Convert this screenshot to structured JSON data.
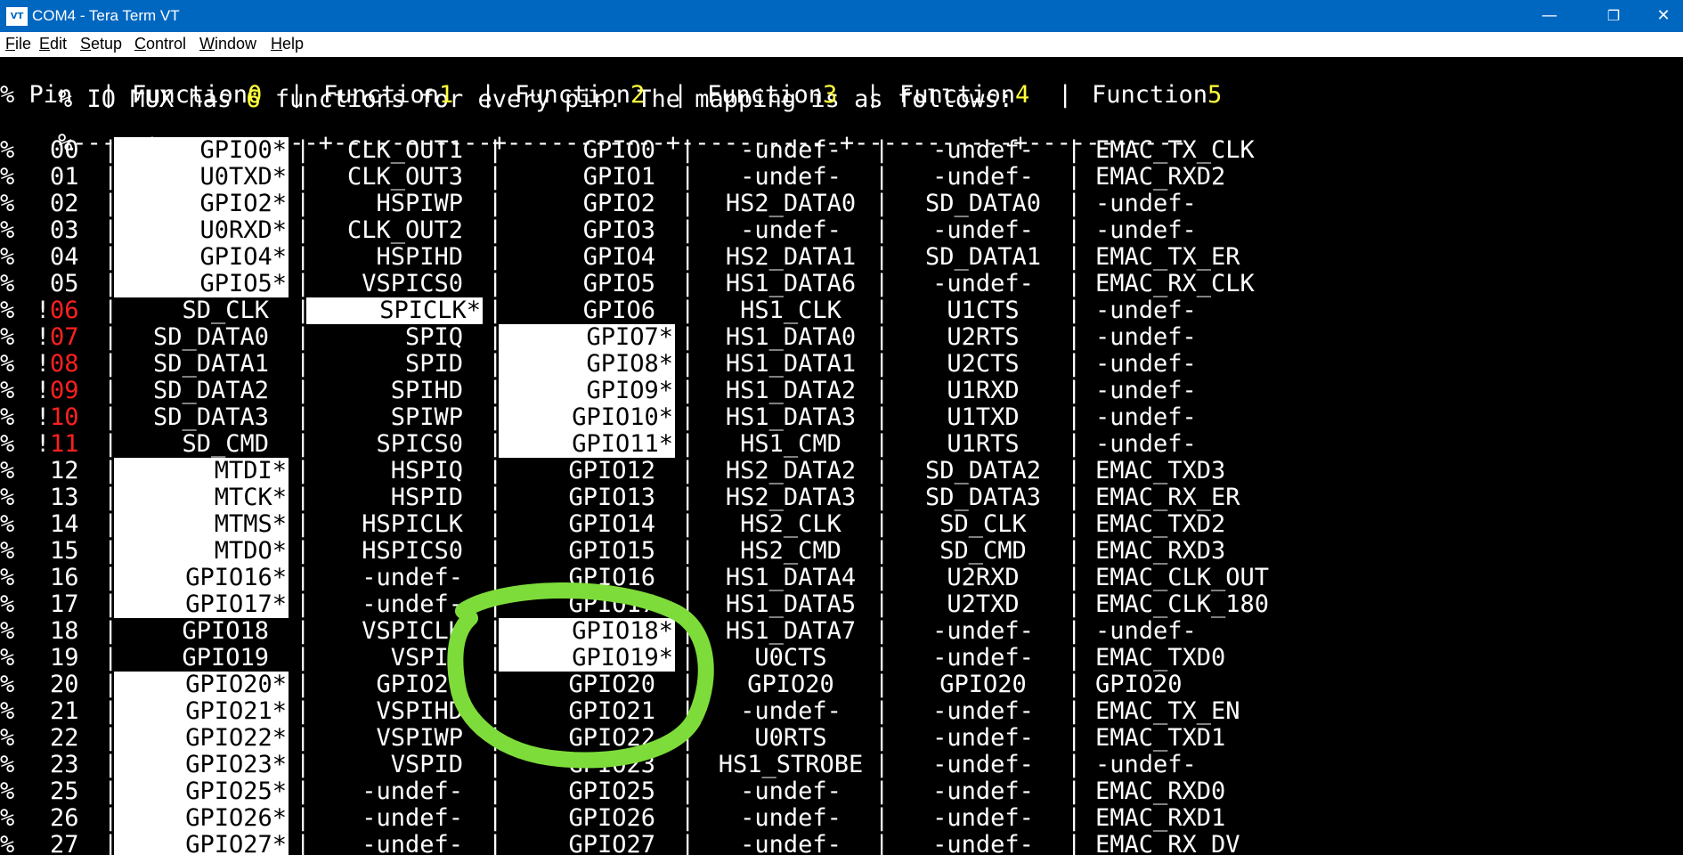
{
  "window": {
    "title": "COM4 - Tera Term VT",
    "icon_label": "VT",
    "icon": "tera-term-icon",
    "controls": {
      "minimize": "—",
      "restore": "❐",
      "close": "✕"
    }
  },
  "menu": [
    {
      "pre": "",
      "acc": "F",
      "post": "ile"
    },
    {
      "pre": "",
      "acc": "E",
      "post": "dit"
    },
    {
      "pre": "",
      "acc": "S",
      "post": "etup"
    },
    {
      "pre": "",
      "acc": "C",
      "post": "ontrol"
    },
    {
      "pre": "",
      "acc": "W",
      "post": "indow"
    },
    {
      "pre": "",
      "acc": "H",
      "post": "elp"
    }
  ],
  "terminal": {
    "intro": {
      "text": "% IO MUX has ",
      "num": "6",
      "rest": " functions for every pin. The mapping is as follows:"
    },
    "header": {
      "prefix": "% Pin  |",
      "functions": [
        {
          "label": "Function",
          "num": "0"
        },
        {
          "label": "Function",
          "num": "1"
        },
        {
          "label": "Function",
          "num": "2"
        },
        {
          "label": "Function",
          "num": "3"
        },
        {
          "label": "Function",
          "num": "4"
        },
        {
          "label": "Function",
          "num": "5"
        }
      ]
    },
    "divider": "%-----+-----------+-----------+-----------+-----------+-----------+-----------",
    "rows": [
      {
        "bang": "",
        "pin": "00",
        "warn": false,
        "f": [
          "GPIO0*",
          "CLK_OUT1",
          "GPIO0",
          "-undef-",
          "-undef-",
          "EMAC_TX_CLK"
        ],
        "hl": [
          true,
          false,
          false
        ]
      },
      {
        "bang": "",
        "pin": "01",
        "warn": false,
        "f": [
          "U0TXD*",
          "CLK_OUT3",
          "GPIO1",
          "-undef-",
          "-undef-",
          "EMAC_RXD2"
        ],
        "hl": [
          true,
          false,
          false
        ]
      },
      {
        "bang": "",
        "pin": "02",
        "warn": false,
        "f": [
          "GPIO2*",
          "HSPIWP",
          "GPIO2",
          "HS2_DATA0",
          "SD_DATA0",
          "-undef-"
        ],
        "hl": [
          true,
          false,
          false
        ]
      },
      {
        "bang": "",
        "pin": "03",
        "warn": false,
        "f": [
          "U0RXD*",
          "CLK_OUT2",
          "GPIO3",
          "-undef-",
          "-undef-",
          "-undef-"
        ],
        "hl": [
          true,
          false,
          false
        ]
      },
      {
        "bang": "",
        "pin": "04",
        "warn": false,
        "f": [
          "GPIO4*",
          "HSPIHD",
          "GPIO4",
          "HS2_DATA1",
          "SD_DATA1",
          "EMAC_TX_ER"
        ],
        "hl": [
          true,
          false,
          false
        ]
      },
      {
        "bang": "",
        "pin": "05",
        "warn": false,
        "f": [
          "GPIO5*",
          "VSPICS0",
          "GPIO5",
          "HS1_DATA6",
          "-undef-",
          "EMAC_RX_CLK"
        ],
        "hl": [
          true,
          false,
          false
        ]
      },
      {
        "bang": "!",
        "pin": "06",
        "warn": true,
        "f": [
          "SD_CLK",
          "SPICLK*",
          "GPIO6",
          "HS1_CLK",
          "U1CTS",
          "-undef-"
        ],
        "hl": [
          false,
          true,
          false
        ]
      },
      {
        "bang": "!",
        "pin": "07",
        "warn": true,
        "f": [
          "SD_DATA0",
          "SPIQ",
          "GPIO7*",
          "HS1_DATA0",
          "U2RTS",
          "-undef-"
        ],
        "hl": [
          false,
          false,
          true
        ]
      },
      {
        "bang": "!",
        "pin": "08",
        "warn": true,
        "f": [
          "SD_DATA1",
          "SPID",
          "GPIO8*",
          "HS1_DATA1",
          "U2CTS",
          "-undef-"
        ],
        "hl": [
          false,
          false,
          true
        ]
      },
      {
        "bang": "!",
        "pin": "09",
        "warn": true,
        "f": [
          "SD_DATA2",
          "SPIHD",
          "GPIO9*",
          "HS1_DATA2",
          "U1RXD",
          "-undef-"
        ],
        "hl": [
          false,
          false,
          true
        ]
      },
      {
        "bang": "!",
        "pin": "10",
        "warn": true,
        "f": [
          "SD_DATA3",
          "SPIWP",
          "GPIO10*",
          "HS1_DATA3",
          "U1TXD",
          "-undef-"
        ],
        "hl": [
          false,
          false,
          true
        ]
      },
      {
        "bang": "!",
        "pin": "11",
        "warn": true,
        "f": [
          "SD_CMD",
          "SPICS0",
          "GPIO11*",
          "HS1_CMD",
          "U1RTS",
          "-undef-"
        ],
        "hl": [
          false,
          false,
          true
        ]
      },
      {
        "bang": "",
        "pin": "12",
        "warn": false,
        "f": [
          "MTDI*",
          "HSPIQ",
          "GPIO12",
          "HS2_DATA2",
          "SD_DATA2",
          "EMAC_TXD3"
        ],
        "hl": [
          true,
          false,
          false
        ]
      },
      {
        "bang": "",
        "pin": "13",
        "warn": false,
        "f": [
          "MTCK*",
          "HSPID",
          "GPIO13",
          "HS2_DATA3",
          "SD_DATA3",
          "EMAC_RX_ER"
        ],
        "hl": [
          true,
          false,
          false
        ]
      },
      {
        "bang": "",
        "pin": "14",
        "warn": false,
        "f": [
          "MTMS*",
          "HSPICLK",
          "GPIO14",
          "HS2_CLK",
          "SD_CLK",
          "EMAC_TXD2"
        ],
        "hl": [
          true,
          false,
          false
        ]
      },
      {
        "bang": "",
        "pin": "15",
        "warn": false,
        "f": [
          "MTDO*",
          "HSPICS0",
          "GPIO15",
          "HS2_CMD",
          "SD_CMD",
          "EMAC_RXD3"
        ],
        "hl": [
          true,
          false,
          false
        ]
      },
      {
        "bang": "",
        "pin": "16",
        "warn": false,
        "f": [
          "GPIO16*",
          "-undef-",
          "GPIO16",
          "HS1_DATA4",
          "U2RXD",
          "EMAC_CLK_OUT"
        ],
        "hl": [
          true,
          false,
          false
        ]
      },
      {
        "bang": "",
        "pin": "17",
        "warn": false,
        "f": [
          "GPIO17*",
          "-undef-",
          "GPIO17",
          "HS1_DATA5",
          "U2TXD",
          "EMAC_CLK_180"
        ],
        "hl": [
          true,
          false,
          false
        ]
      },
      {
        "bang": "",
        "pin": "18",
        "warn": false,
        "f": [
          "GPIO18",
          "VSPICLK",
          "GPIO18*",
          "HS1_DATA7",
          "-undef-",
          "-undef-"
        ],
        "hl": [
          false,
          false,
          true
        ]
      },
      {
        "bang": "",
        "pin": "19",
        "warn": false,
        "f": [
          "GPIO19",
          "VSPIQ",
          "GPIO19*",
          "U0CTS",
          "-undef-",
          "EMAC_TXD0"
        ],
        "hl": [
          false,
          false,
          true
        ]
      },
      {
        "bang": "",
        "pin": "20",
        "warn": false,
        "f": [
          "GPIO20*",
          "GPIO20",
          "GPIO20",
          "GPIO20",
          "GPIO20",
          "GPIO20"
        ],
        "hl": [
          true,
          false,
          false
        ]
      },
      {
        "bang": "",
        "pin": "21",
        "warn": false,
        "f": [
          "GPIO21*",
          "VSPIHD",
          "GPIO21",
          "-undef-",
          "-undef-",
          "EMAC_TX_EN"
        ],
        "hl": [
          true,
          false,
          false
        ]
      },
      {
        "bang": "",
        "pin": "22",
        "warn": false,
        "f": [
          "GPIO22*",
          "VSPIWP",
          "GPIO22",
          "U0RTS",
          "-undef-",
          "EMAC_TXD1"
        ],
        "hl": [
          true,
          false,
          false
        ]
      },
      {
        "bang": "",
        "pin": "23",
        "warn": false,
        "f": [
          "GPIO23*",
          "VSPID",
          "GPIO23",
          "HS1_STROBE",
          "-undef-",
          "-undef-"
        ],
        "hl": [
          true,
          false,
          false
        ]
      },
      {
        "bang": "",
        "pin": "25",
        "warn": false,
        "f": [
          "GPIO25*",
          "-undef-",
          "GPIO25",
          "-undef-",
          "-undef-",
          "EMAC_RXD0"
        ],
        "hl": [
          true,
          false,
          false
        ]
      },
      {
        "bang": "",
        "pin": "26",
        "warn": false,
        "f": [
          "GPIO26*",
          "-undef-",
          "GPIO26",
          "-undef-",
          "-undef-",
          "EMAC_RXD1"
        ],
        "hl": [
          true,
          false,
          false
        ]
      },
      {
        "bang": "",
        "pin": "27",
        "warn": false,
        "f": [
          "GPIO27*",
          "-undef-",
          "GPIO27",
          "-undef-",
          "-undef-",
          "EMAC_RX_DV"
        ],
        "hl": [
          true,
          false,
          false
        ]
      }
    ]
  },
  "annotation": {
    "color": "#7ddc3a",
    "shape": "circle",
    "target": "pins 17-21 Function2"
  }
}
